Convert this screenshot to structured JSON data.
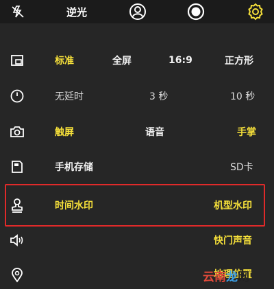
{
  "top_bar": {
    "flash_off_icon": "flash-off-icon",
    "backlight_label": "逆光",
    "face_icon": "person-circle-icon",
    "shutter_icon": "record-circle-icon",
    "settings_icon": "gear-icon"
  },
  "rows": {
    "ratio": {
      "icon": "aspect-ratio-icon",
      "options": [
        "标准",
        "全屏",
        "16:9",
        "正方形"
      ]
    },
    "timer": {
      "icon": "timer-icon",
      "options": [
        "无延时",
        "3 秒",
        "10 秒"
      ]
    },
    "capture": {
      "icon": "camera-icon",
      "options": [
        "触屏",
        "语音",
        "手掌"
      ]
    },
    "storage": {
      "icon": "storage-icon",
      "options": [
        "手机存储",
        "SD卡"
      ]
    },
    "watermark": {
      "icon": "stamp-icon",
      "options": [
        "时间水印",
        "机型水印"
      ]
    },
    "sound": {
      "icon": "speaker-icon",
      "option": "快门声音"
    },
    "location": {
      "icon": "location-pin-icon",
      "option": "地理位置"
    }
  },
  "site_watermark": {
    "part1": "云",
    "part2": "南",
    "part3": "龙",
    "part4": "网"
  },
  "colors": {
    "background": "#262626",
    "top_bar": "#1b1b1b",
    "accent_yellow": "#f6e03a",
    "highlight_red": "#e02a2a"
  }
}
